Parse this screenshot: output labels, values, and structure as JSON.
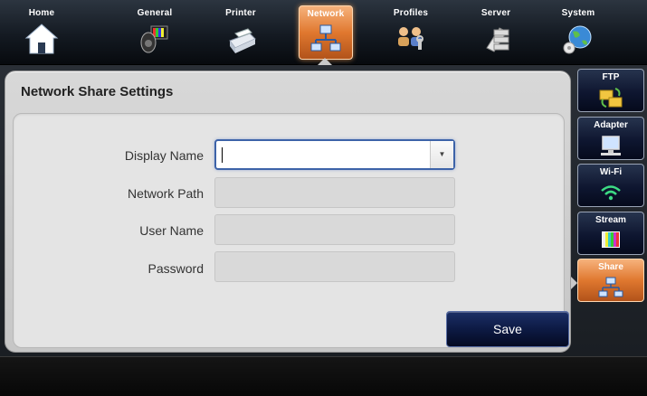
{
  "nav": {
    "tabs": [
      {
        "label": "Home",
        "icon": "home-icon"
      },
      {
        "label": "General",
        "icon": "speaker-monitor-icon"
      },
      {
        "label": "Printer",
        "icon": "printer-icon"
      },
      {
        "label": "Network",
        "icon": "network-icon",
        "active": true
      },
      {
        "label": "Profiles",
        "icon": "users-icon"
      },
      {
        "label": "Server",
        "icon": "server-icon"
      },
      {
        "label": "System",
        "icon": "globe-icon"
      }
    ]
  },
  "panel": {
    "title": "Network Share Settings"
  },
  "form": {
    "display_name": {
      "label": "Display Name",
      "value": ""
    },
    "network_path": {
      "label": "Network Path",
      "value": ""
    },
    "user_name": {
      "label": "User Name",
      "value": ""
    },
    "password": {
      "label": "Password",
      "value": ""
    },
    "save_label": "Save"
  },
  "side": {
    "tabs": [
      {
        "label": "FTP",
        "icon": "ftp-folder-icon"
      },
      {
        "label": "Adapter",
        "icon": "adapter-monitor-icon"
      },
      {
        "label": "Wi-Fi",
        "icon": "wifi-icon"
      },
      {
        "label": "Stream",
        "icon": "color-bars-icon"
      },
      {
        "label": "Share",
        "icon": "share-network-icon",
        "active": true
      }
    ]
  },
  "colors": {
    "active_orange": "#e0782f",
    "dark_navy": "#0e1630",
    "focus_blue": "#3d63a8"
  }
}
